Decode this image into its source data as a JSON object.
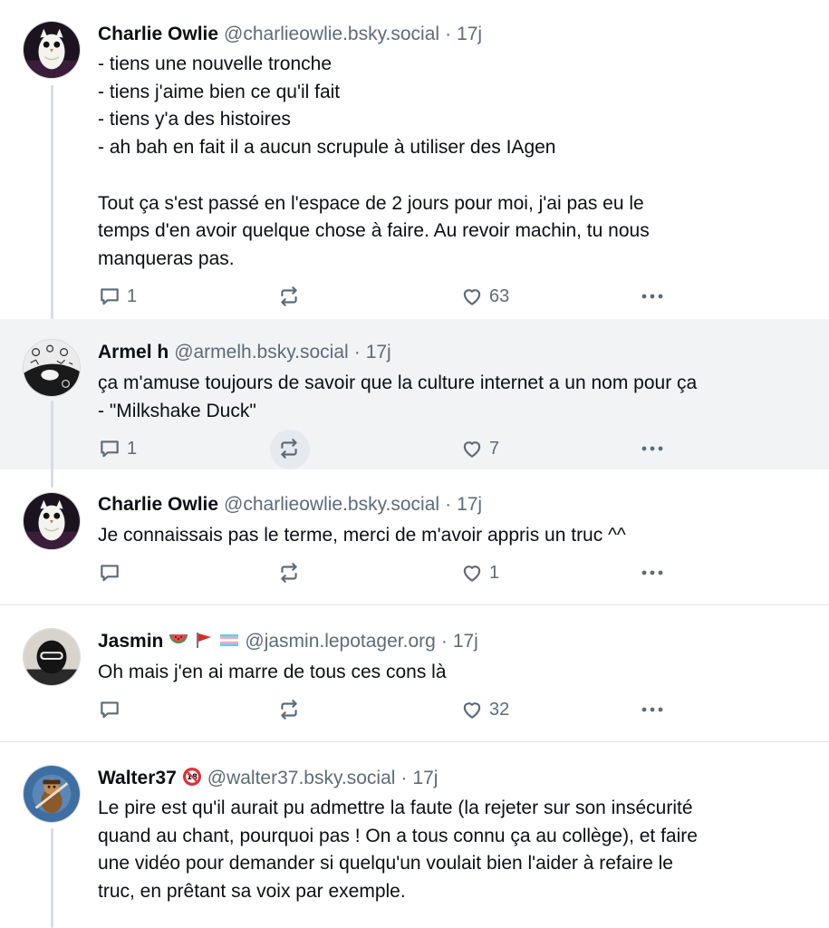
{
  "posts": [
    {
      "author": "Charlie Owlie",
      "handle": "@charlieowlie.bsky.social",
      "time": "17j",
      "avatar_icon": "owl-avatar",
      "lines": [
        "- tiens une nouvelle tronche",
        "- tiens j'aime bien ce qu'il fait",
        "- tiens y'a des histoires",
        "- ah bah en fait il a aucun scrupule à utiliser des IAgen",
        "",
        "Tout ça s'est passé en l'espace de 2 jours pour moi, j'ai pas eu le",
        "temps d'en avoir quelque chose à faire. Au revoir machin, tu nous",
        "manqueras pas."
      ],
      "replies": "1",
      "reposts": "",
      "likes": "63"
    },
    {
      "author": "Armel h",
      "handle": "@armelh.bsky.social",
      "time": "17j",
      "avatar_icon": "doodle-avatar",
      "lines": [
        "ça m'amuse toujours de savoir que la culture internet a un nom pour ça",
        "- \"Milkshake Duck\""
      ],
      "replies": "1",
      "reposts": "",
      "likes": "7"
    },
    {
      "author": "Charlie Owlie",
      "handle": "@charlieowlie.bsky.social",
      "time": "17j",
      "avatar_icon": "owl-avatar",
      "lines": [
        "Je connaissais pas le terme, merci de m'avoir appris un truc ^^"
      ],
      "replies": "",
      "reposts": "",
      "likes": "1"
    },
    {
      "author": "Jasmin",
      "name_emojis": [
        "🍉",
        "🚩",
        "🏳️‍⚧️"
      ],
      "handle": "@jasmin.lepotager.org",
      "time": "17j",
      "avatar_icon": "helmet-avatar",
      "lines": [
        "Oh mais j'en ai marre de tous ces cons là"
      ],
      "replies": "",
      "reposts": "",
      "likes": "32"
    },
    {
      "author": "Walter37",
      "name_emojis": [
        "🔞"
      ],
      "handle": "@walter37.bsky.social",
      "time": "17j",
      "avatar_icon": "cartoon-avatar",
      "lines": [
        "Le pire est qu'il aurait pu admettre la faute (la rejeter sur son insécurité",
        "quand au chant, pourquoi pas ! On a tous connu ça au collège), et faire",
        "une vidéo pour demander si quelqu'un voulait bien l'aider à refaire le",
        "truc, en prêtant sa voix par exemple."
      ]
    }
  ],
  "separator": "·",
  "colors": {
    "text": "#0b0f14",
    "muted": "#5d6b79",
    "highlight": "#f1f3f5",
    "divider": "#dfe3e8",
    "thread_line": "#d8dde3"
  }
}
